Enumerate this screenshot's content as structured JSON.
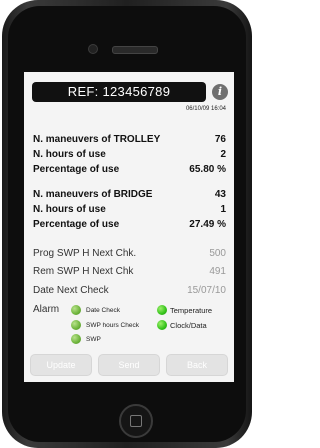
{
  "header": {
    "ref": "REF: 123456789",
    "info_icon": "i",
    "datetime": "06/10/09 16:04"
  },
  "trolley": [
    {
      "label": "N. maneuvers of TROLLEY",
      "value": "76"
    },
    {
      "label": "N. hours of use",
      "value": "2"
    },
    {
      "label": "Percentage of use",
      "value": "65.80 %"
    }
  ],
  "bridge": [
    {
      "label": "N. maneuvers of BRIDGE",
      "value": "43"
    },
    {
      "label": "N. hours of use",
      "value": "1"
    },
    {
      "label": "Percentage of use",
      "value": "27.49 %"
    }
  ],
  "checks": [
    {
      "label": "Prog SWP H Next Chk.",
      "value": "500"
    },
    {
      "label": "Rem SWP H Next Chk",
      "value": "491"
    },
    {
      "label": "Date Next Check",
      "value": "15/07/10"
    }
  ],
  "alarm": {
    "label": "Alarm",
    "items": [
      {
        "label": "Date Check"
      },
      {
        "label": "SWP hours Check"
      },
      {
        "label": "SWP"
      },
      {
        "label": "Temperature"
      },
      {
        "label": "Clock/Data"
      }
    ]
  },
  "buttons": {
    "update": "Update",
    "send": "Send",
    "back": "Back"
  },
  "colors": {
    "screen_bg": "#f4f4f4",
    "ref_bar": "#111111",
    "alarm_dot": "#6cb33a",
    "alarm_dot_bright": "#33c21a"
  }
}
